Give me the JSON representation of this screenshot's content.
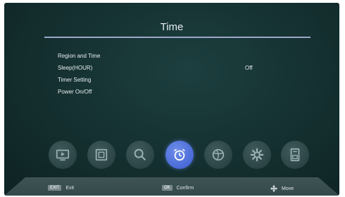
{
  "header": {
    "title": "Time"
  },
  "menu": {
    "items": [
      {
        "label": "Region and Time",
        "value": ""
      },
      {
        "label": "Sleep(HOUR)",
        "value": "Off"
      },
      {
        "label": "Timer Setting",
        "value": ""
      },
      {
        "label": "Power On/Off",
        "value": ""
      }
    ]
  },
  "icon_bar": {
    "icons": [
      {
        "name": "media-player-icon",
        "active": false
      },
      {
        "name": "picture-icon",
        "active": false
      },
      {
        "name": "search-icon",
        "active": false
      },
      {
        "name": "alarm-clock-icon",
        "active": true
      },
      {
        "name": "globe-icon",
        "active": false
      },
      {
        "name": "gear-icon",
        "active": false
      },
      {
        "name": "storage-icon",
        "active": false
      }
    ],
    "active_color": "#4a6ad8"
  },
  "footer": {
    "exit_key": "EXIT",
    "exit_label": "Exit",
    "ok_key": "OK",
    "ok_label": "Confirm",
    "move_label": "Move"
  }
}
